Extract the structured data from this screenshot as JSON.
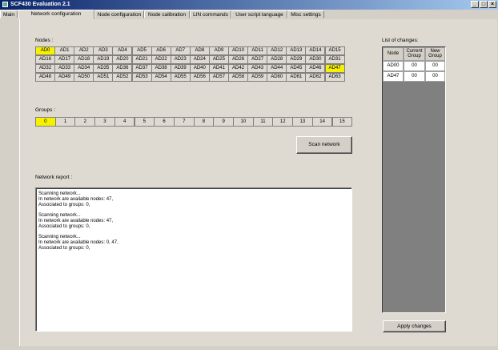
{
  "window": {
    "title": "SCF430 Evaluation 2.1"
  },
  "tabs": [
    "Main",
    "Network configuration",
    "Node configuration",
    "Node calibration",
    "LIN commands",
    "User script language",
    "Misc settings"
  ],
  "nodes": {
    "label": "Nodes :",
    "rows": [
      [
        "AD0",
        "AD1",
        "AD2",
        "AD3",
        "AD4",
        "AD5",
        "AD6",
        "AD7",
        "AD8",
        "AD9",
        "AD10",
        "AD11",
        "AD12",
        "AD13",
        "AD14",
        "AD15"
      ],
      [
        "AD16",
        "AD17",
        "AD18",
        "AD19",
        "AD20",
        "AD21",
        "AD22",
        "AD23",
        "AD24",
        "AD25",
        "AD26",
        "AD27",
        "AD28",
        "AD29",
        "AD30",
        "AD31"
      ],
      [
        "AD32",
        "AD33",
        "AD34",
        "AD35",
        "AD36",
        "AD37",
        "AD38",
        "AD39",
        "AD40",
        "AD41",
        "AD42",
        "AD43",
        "AD44",
        "AD45",
        "AD46",
        "AD47"
      ],
      [
        "AD48",
        "AD49",
        "AD50",
        "AD51",
        "AD52",
        "AD53",
        "AD54",
        "AD55",
        "AD56",
        "AD57",
        "AD58",
        "AD59",
        "AD60",
        "AD61",
        "AD62",
        "AD63"
      ]
    ],
    "highlighted": [
      "AD0",
      "AD47"
    ]
  },
  "groups": {
    "label": "Groups :",
    "items": [
      "0",
      "1",
      "2",
      "3",
      "4",
      "5",
      "6",
      "7",
      "8",
      "9",
      "10",
      "11",
      "12",
      "13",
      "14",
      "15"
    ],
    "highlighted": [
      "0"
    ]
  },
  "scan_button": "Scan network",
  "report": {
    "label": "Network report :",
    "blocks": [
      [
        "Scanning network...",
        "In network are available nodes: 47,",
        "Associated to groups: 0,"
      ],
      [
        "Scanning network...",
        "In network are available nodes: 47,",
        "Associated to groups: 0,"
      ],
      [
        "Scanning network...",
        "In network are available nodes: 0, 47,",
        "Associated to groups: 0,"
      ]
    ]
  },
  "changes": {
    "label": "List of changes:",
    "headers": [
      "Node",
      "Current Group",
      "New Group"
    ],
    "rows": [
      [
        "AD00",
        "00",
        "00"
      ],
      [
        "AD47",
        "00",
        "00"
      ]
    ]
  },
  "apply_button": "Apply changes",
  "colors": {
    "highlight": "#f6f100",
    "panel": "#dedad2",
    "chrome": "#d4d0c8"
  }
}
